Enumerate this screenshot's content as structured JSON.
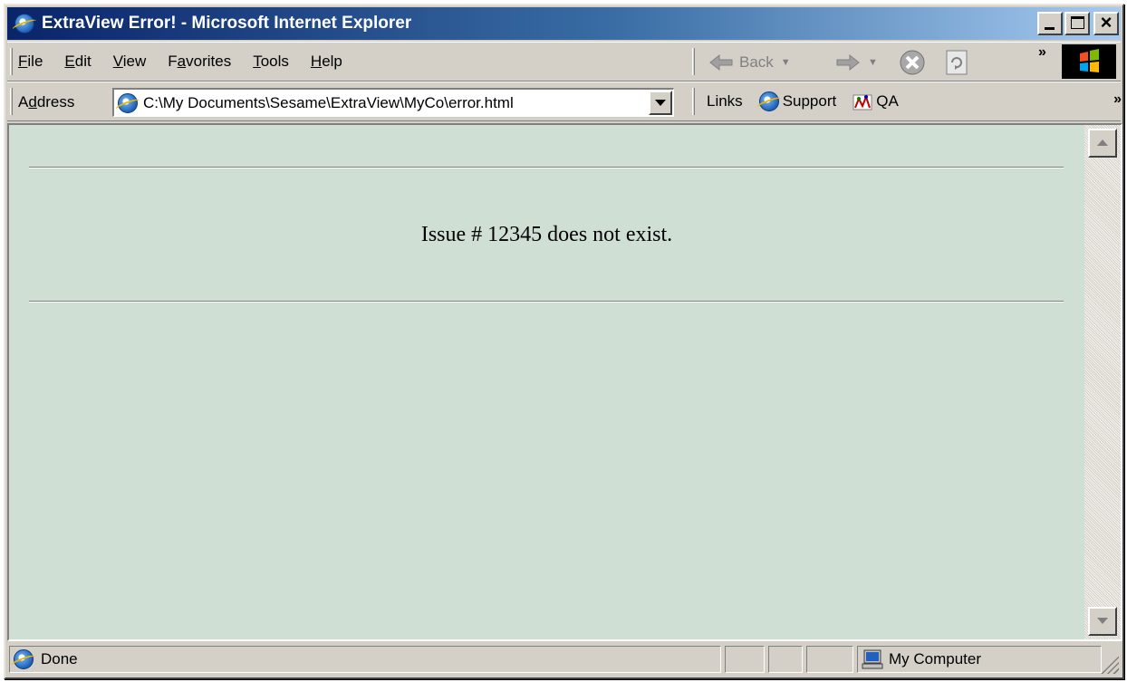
{
  "window": {
    "title": "ExtraView Error! - Microsoft Internet Explorer"
  },
  "menu": {
    "items": [
      {
        "accel": "F",
        "rest": "ile"
      },
      {
        "accel": "E",
        "rest": "dit"
      },
      {
        "accel": "V",
        "rest": "iew"
      },
      {
        "pre": "F",
        "accel": "a",
        "rest": "vorites"
      },
      {
        "accel": "T",
        "rest": "ools"
      },
      {
        "accel": "H",
        "rest": "elp"
      }
    ]
  },
  "navigation": {
    "back_label": "Back"
  },
  "address": {
    "label_pre": "A",
    "label_accel": "d",
    "label_rest": "dress",
    "value": "C:\\My Documents\\Sesame\\ExtraView\\MyCo\\error.html"
  },
  "links": {
    "label": "Links",
    "items": [
      "Support",
      "QA"
    ]
  },
  "page": {
    "message": "Issue # 12345 does not exist.",
    "background": "#cfdfd3"
  },
  "status": {
    "text": "Done",
    "zone": "My Computer"
  }
}
